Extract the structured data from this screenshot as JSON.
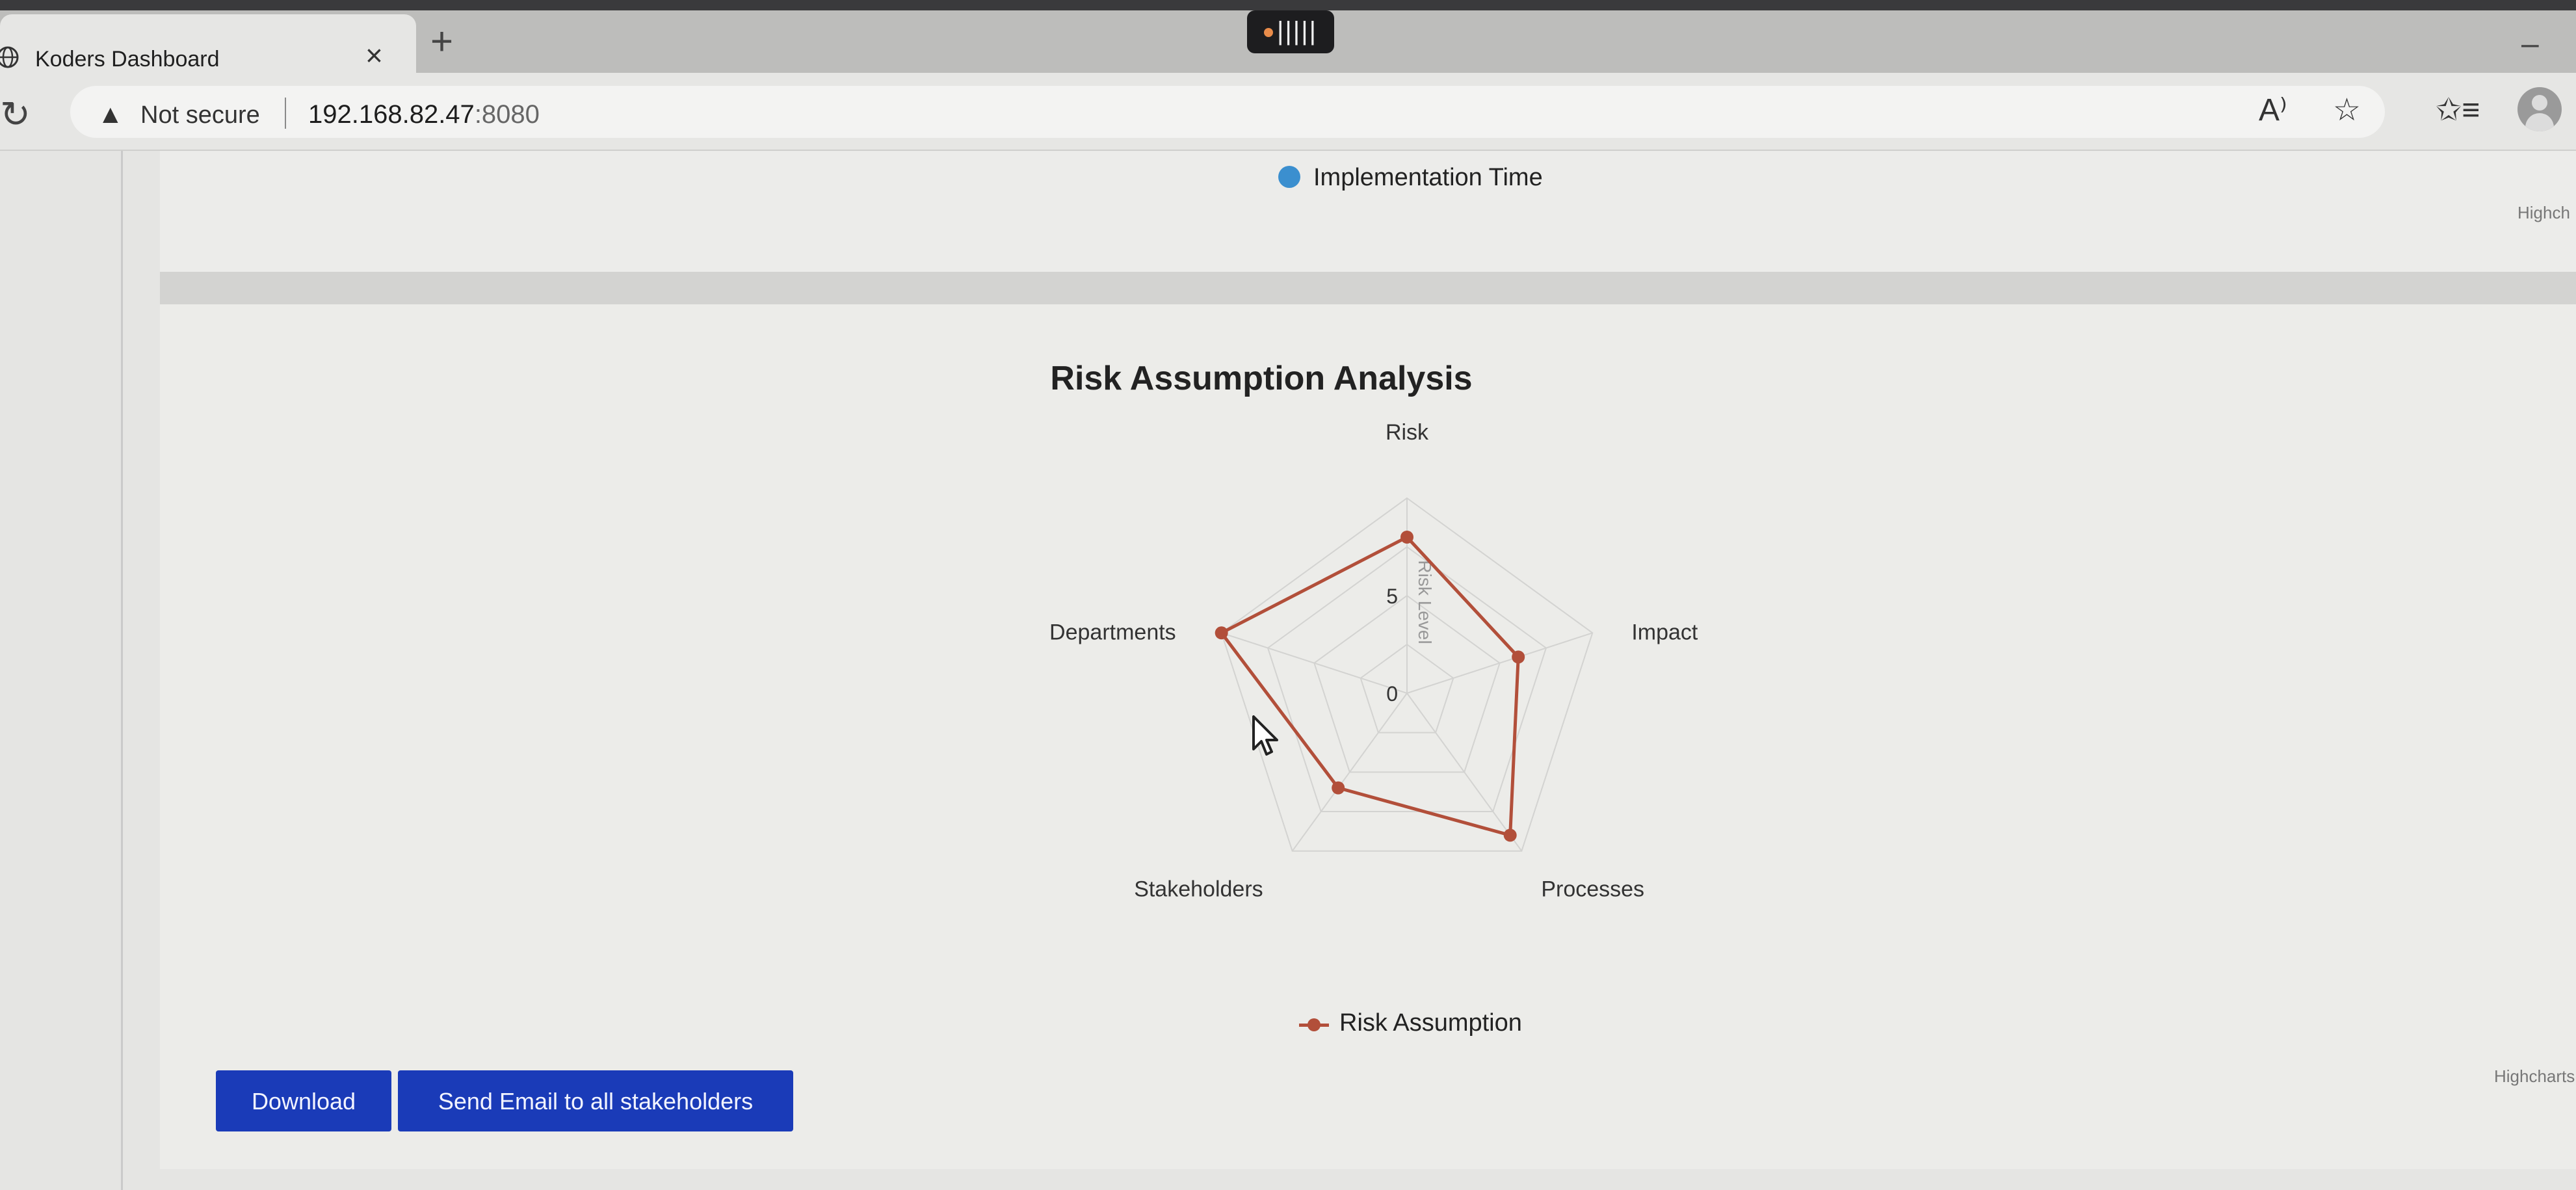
{
  "browser": {
    "tab_title": "Koders Dashboard",
    "close_symbol": "×",
    "new_tab_symbol": "+",
    "recording_indicator": "|||||",
    "minimize_symbol": "–",
    "reload_symbol": "↻",
    "security_warning_icon": "▲",
    "security_label": "Not secure",
    "url_host": "192.168.82.47",
    "url_port": ":8080",
    "read_aloud_icon": "A⁾",
    "favorite_icon": "☆",
    "favorites_icon": "✩≡"
  },
  "top_chart": {
    "legend_label": "Implementation Time",
    "legend_color": "#3b8fcf",
    "credit": "Highch"
  },
  "chart_data": {
    "type": "radar",
    "title": "Risk Assumption Analysis",
    "axis_title": "Risk Level",
    "categories": [
      "Risk",
      "Impact",
      "Processes",
      "Stakeholders",
      "Departments"
    ],
    "y_ticks": [
      0,
      5
    ],
    "ylim": [
      0,
      10
    ],
    "grid": true,
    "legend_position": "bottom",
    "series": [
      {
        "name": "Risk Assumption",
        "color": "#b24f3a",
        "values": [
          8,
          6,
          9,
          6,
          10
        ]
      }
    ],
    "credit": "Highcharts"
  },
  "actions": {
    "download_label": "Download",
    "email_label": "Send Email to all stakeholders"
  }
}
